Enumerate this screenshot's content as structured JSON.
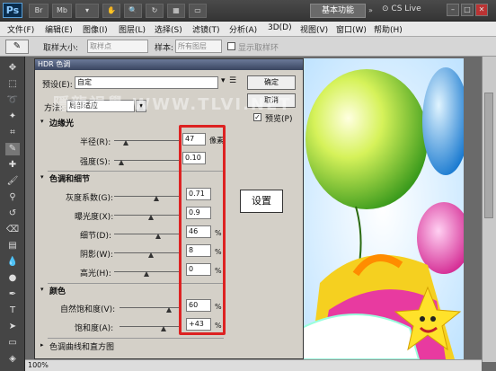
{
  "app": {
    "logo": "Ps",
    "workspace": "基本功能",
    "cslive": "CS Live"
  },
  "menu": [
    "文件(F)",
    "编辑(E)",
    "图像(I)",
    "图层(L)",
    "选择(S)",
    "滤镜(T)",
    "分析(A)",
    "3D(D)",
    "视图(V)",
    "窗口(W)",
    "帮助(H)"
  ],
  "options": {
    "sample_size_label": "取样大小:",
    "sample_size_value": "取样点",
    "sample_label": "样本:",
    "sample_value": "所有图层",
    "show_ring": "显示取样环"
  },
  "status": {
    "zoom": "100%"
  },
  "dialog": {
    "title": "HDR 色调",
    "preset_label": "预设(E):",
    "preset_value": "自定",
    "method_label": "方法:",
    "method_value": "局部适应",
    "ok": "确定",
    "cancel": "取消",
    "preview": "预览(P)",
    "watermark": "隱龍視覺 WWW.TLVI.NET",
    "edge_glow": {
      "title": "边缘光",
      "radius_label": "半径(R):",
      "radius_value": "47",
      "radius_unit": "像素",
      "strength_label": "强度(S):",
      "strength_value": "0.10"
    },
    "tone_detail": {
      "title": "色调和细节",
      "gamma_label": "灰度系数(G):",
      "gamma_value": "0.71",
      "exposure_label": "曝光度(X):",
      "exposure_value": "0.9",
      "detail_label": "细节(D):",
      "detail_value": "46",
      "detail_unit": "%",
      "shadow_label": "阴影(W):",
      "shadow_value": "8",
      "shadow_unit": "%",
      "highlight_label": "高光(H):",
      "highlight_value": "0",
      "highlight_unit": "%"
    },
    "color": {
      "title": "颜色",
      "vibrance_label": "自然饱和度(V):",
      "vibrance_value": "60",
      "vibrance_unit": "%",
      "saturation_label": "饱和度(A):",
      "saturation_value": "+43",
      "saturation_unit": "%"
    },
    "curve_section": "色调曲线和直方图"
  },
  "annotation": "设置",
  "colors": {
    "highlight": "#dd2222",
    "dialog_bg": "#d4d0c8",
    "toolbar": "#454545"
  }
}
